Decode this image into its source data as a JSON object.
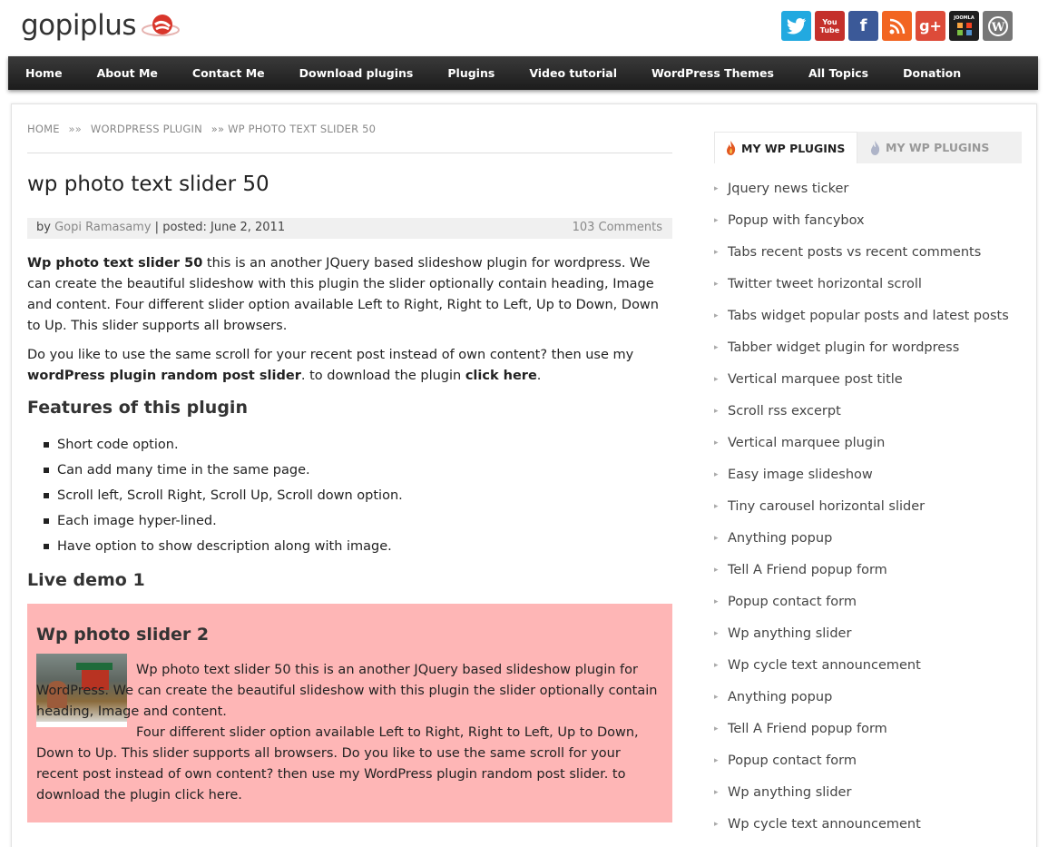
{
  "header": {
    "logo_text": "gopiplus",
    "social": [
      "twitter-icon",
      "youtube-icon",
      "facebook-icon",
      "rss-icon",
      "google-plus-icon",
      "joomla-icon",
      "wordpress-icon"
    ],
    "social_labels": {
      "youtube": "You Tube",
      "joomla": "JOOMLA"
    }
  },
  "nav": [
    "Home",
    "About Me",
    "Contact Me",
    "Download plugins",
    "Plugins",
    "Video tutorial",
    "WordPress Themes",
    "All Topics",
    "Donation"
  ],
  "breadcrumb": [
    "HOME",
    "»»",
    "WORDPRESS PLUGIN",
    "»» WP PHOTO TEXT SLIDER 50"
  ],
  "post": {
    "title": "wp photo text slider 50",
    "meta_by": "by ",
    "author": "Gopi Ramasamy",
    "meta_posted": " | posted: June 2, 2011",
    "comments": "103 Comments",
    "p1_bold": "Wp photo text slider 50",
    "p1_rest": " this is an another JQuery based slideshow plugin for wordpress. We can create the beautiful slideshow with this plugin the slider optionally contain heading, Image and content. Four different slider option available Left to Right, Right to Left, Up to Down, Down to Up. This slider supports all browsers.",
    "p2_a": "Do you like to use the same scroll for your recent post instead of own content? then use my ",
    "p2_link": "wordPress plugin random post slider",
    "p2_b": ". to download the plugin ",
    "p2_click": "click here",
    "p2_end": ".",
    "features_heading": "Features of this plugin",
    "features": [
      "Short code option.",
      "Can add many time in the same page.",
      "Scroll left, Scroll Right, Scroll Up, Scroll down option.",
      "Each image hyper-lined.",
      "Have option to show description along with image."
    ],
    "demo_heading": "Live demo 1"
  },
  "demo": {
    "title": "Wp photo slider 2",
    "text": "Wp photo text slider 50 this is an another JQuery based slideshow plugin for WordPress. We can create the beautiful slideshow with this plugin the slider optionally contain heading, Image and content.",
    "text2": "Four different slider option available Left to Right, Right to Left, Up to Down, Down to Up. This slider supports all browsers. Do you like to use the same scroll for your recent post instead of own content? then use my WordPress plugin random post slider. to download the plugin click here."
  },
  "sidebar": {
    "tab_active": "MY WP PLUGINS",
    "tab_inactive": "MY WP PLUGINS",
    "items": [
      "Jquery news ticker",
      "Popup with fancybox",
      "Tabs recent posts vs recent comments",
      "Twitter tweet horizontal scroll",
      "Tabs widget popular posts and latest posts",
      "Tabber widget plugin for wordpress",
      "Vertical marquee post title",
      "Scroll rss excerpt",
      "Vertical marquee plugin",
      "Easy image slideshow",
      "Tiny carousel horizontal slider",
      "Anything popup",
      "Tell A Friend popup form",
      "Popup contact form",
      "Wp anything slider",
      "Wp cycle text announcement",
      "Anything popup",
      "Tell A Friend popup form",
      "Popup contact form",
      "Wp anything slider",
      "Wp cycle text announcement"
    ]
  },
  "colors": {
    "demo_bg": "#feb6b6",
    "nav_bg": "#262626",
    "logo_accent": "#d9362b"
  }
}
